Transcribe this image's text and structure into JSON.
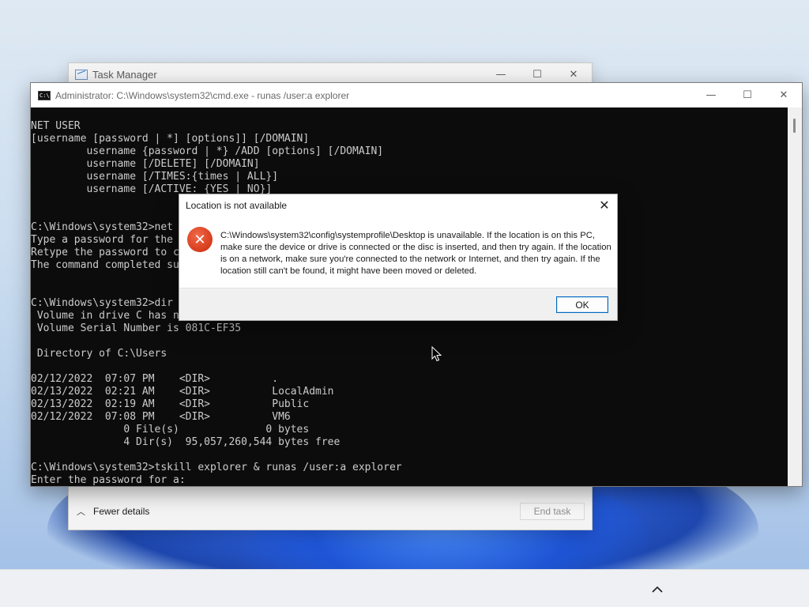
{
  "task_manager": {
    "title": "Task Manager",
    "controls": {
      "minimize": "—",
      "maximize": "☐",
      "close": "✕"
    },
    "fewer_details_label": "Fewer details",
    "end_task_label": "End task"
  },
  "cmd": {
    "title": "Administrator: C:\\Windows\\system32\\cmd.exe - runas  /user:a explorer",
    "icon_text": "C:\\",
    "controls": {
      "minimize": "—",
      "maximize": "☐",
      "close": "✕"
    },
    "lines": [
      "NET USER",
      "[username [password | *] [options]] [/DOMAIN]",
      "         username {password | *} /ADD [options] [/DOMAIN]",
      "         username [/DELETE] [/DOMAIN]",
      "         username [/TIMES:{times | ALL}]",
      "         username [/ACTIVE: {YES | NO}]",
      "",
      "",
      "C:\\Windows\\system32>net",
      "Type a password for the",
      "Retype the password to c",
      "The command completed su",
      "",
      "",
      "C:\\Windows\\system32>dir",
      " Volume in drive C has n",
      " Volume Serial Number is 081C-EF35",
      "",
      " Directory of C:\\Users",
      "",
      "02/12/2022  07:07 PM    <DIR>          .",
      "02/13/2022  02:21 AM    <DIR>          LocalAdmin",
      "02/13/2022  02:19 AM    <DIR>          Public",
      "02/12/2022  07:08 PM    <DIR>          VM6",
      "               0 File(s)              0 bytes",
      "               4 Dir(s)  95,057,260,544 bytes free",
      "",
      "C:\\Windows\\system32>tskill explorer & runas /user:a explorer",
      "Enter the password for a:"
    ]
  },
  "dialog": {
    "title": "Location is not available",
    "close": "✕",
    "icon": "error-icon",
    "icon_glyph": "✕",
    "message": "C:\\Windows\\system32\\config\\systemprofile\\Desktop is unavailable. If the location is on this PC, make sure the device or drive is connected or the disc is inserted, and then try again. If the location is on a network, make sure you're connected to the network or Internet, and then try again. If the location still can't be found, it might have been moved or deleted.",
    "ok_label": "OK"
  },
  "taskbar": {
    "tray_chevron": "chevron-up-icon"
  },
  "colors": {
    "accent": "#0067c0",
    "error": "#d63c1c",
    "console_bg": "#0c0c0c",
    "console_fg": "#cccccc"
  }
}
